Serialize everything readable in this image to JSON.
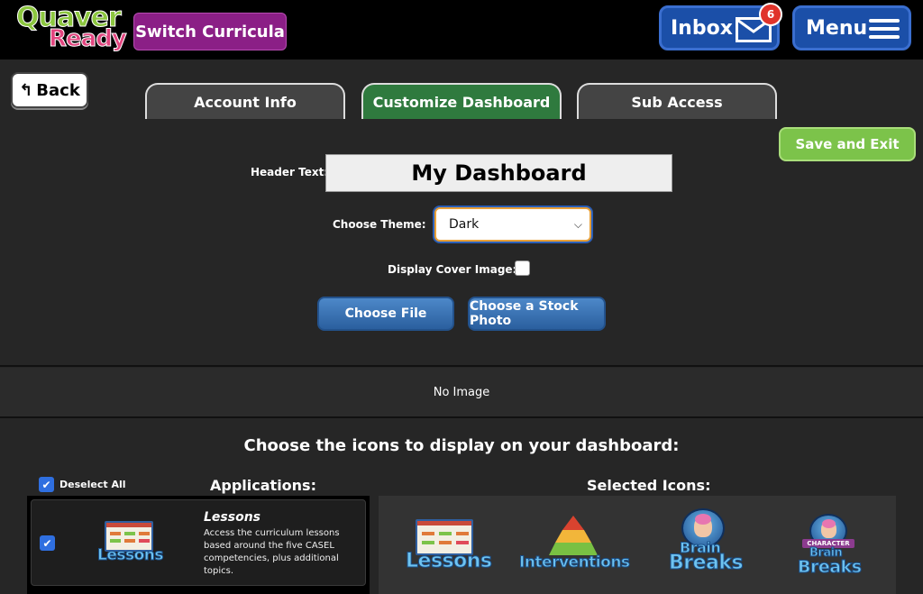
{
  "header": {
    "logo_top": "Quaver",
    "logo_bottom": "Ready",
    "switch_label": "Switch Curricula",
    "inbox_label": "Inbox",
    "inbox_count": "6",
    "menu_label": "Menu"
  },
  "nav": {
    "back_label": "Back",
    "tabs": [
      {
        "label": "Account Info",
        "active": false
      },
      {
        "label": "Customize Dashboard",
        "active": true
      },
      {
        "label": "Sub Access",
        "active": false
      }
    ],
    "save_exit_label": "Save and Exit"
  },
  "form": {
    "header_text_label": "Header Text:",
    "header_text_value": "My Dashboard",
    "theme_label": "Choose Theme:",
    "theme_value": "Dark",
    "cover_label": "Display Cover Image:",
    "cover_checked": false,
    "choose_file_label": "Choose File",
    "stock_photo_label": "Choose a Stock Photo",
    "no_image_text": "No Image"
  },
  "icons_section": {
    "title": "Choose the icons to display on your dashboard:",
    "deselect_all_label": "Deselect All",
    "applications_heading": "Applications:",
    "selected_heading": "Selected Icons:",
    "applications": [
      {
        "title": "Lessons",
        "description": "Access the curriculum lessons based around the five CASEL competencies, plus additional topics.",
        "icon_word": "Lessons",
        "checked": true
      }
    ],
    "selected": [
      {
        "word": "Lessons",
        "icon": "lessons-icon"
      },
      {
        "word": "Interventions",
        "icon": "interventions-icon"
      },
      {
        "word_top": "Brain",
        "word_bottom": "Breaks",
        "icon": "brain-breaks-icon"
      },
      {
        "banner": "CHARACTER",
        "word_top": "Brain",
        "word_bottom": "Breaks",
        "icon": "character-brain-breaks-icon"
      }
    ]
  },
  "colors": {
    "active_tab": "#2f7a3e",
    "save_button": "#7cc34a",
    "switch_button": "#8b1f86",
    "header_button": "#1b4fa8"
  }
}
